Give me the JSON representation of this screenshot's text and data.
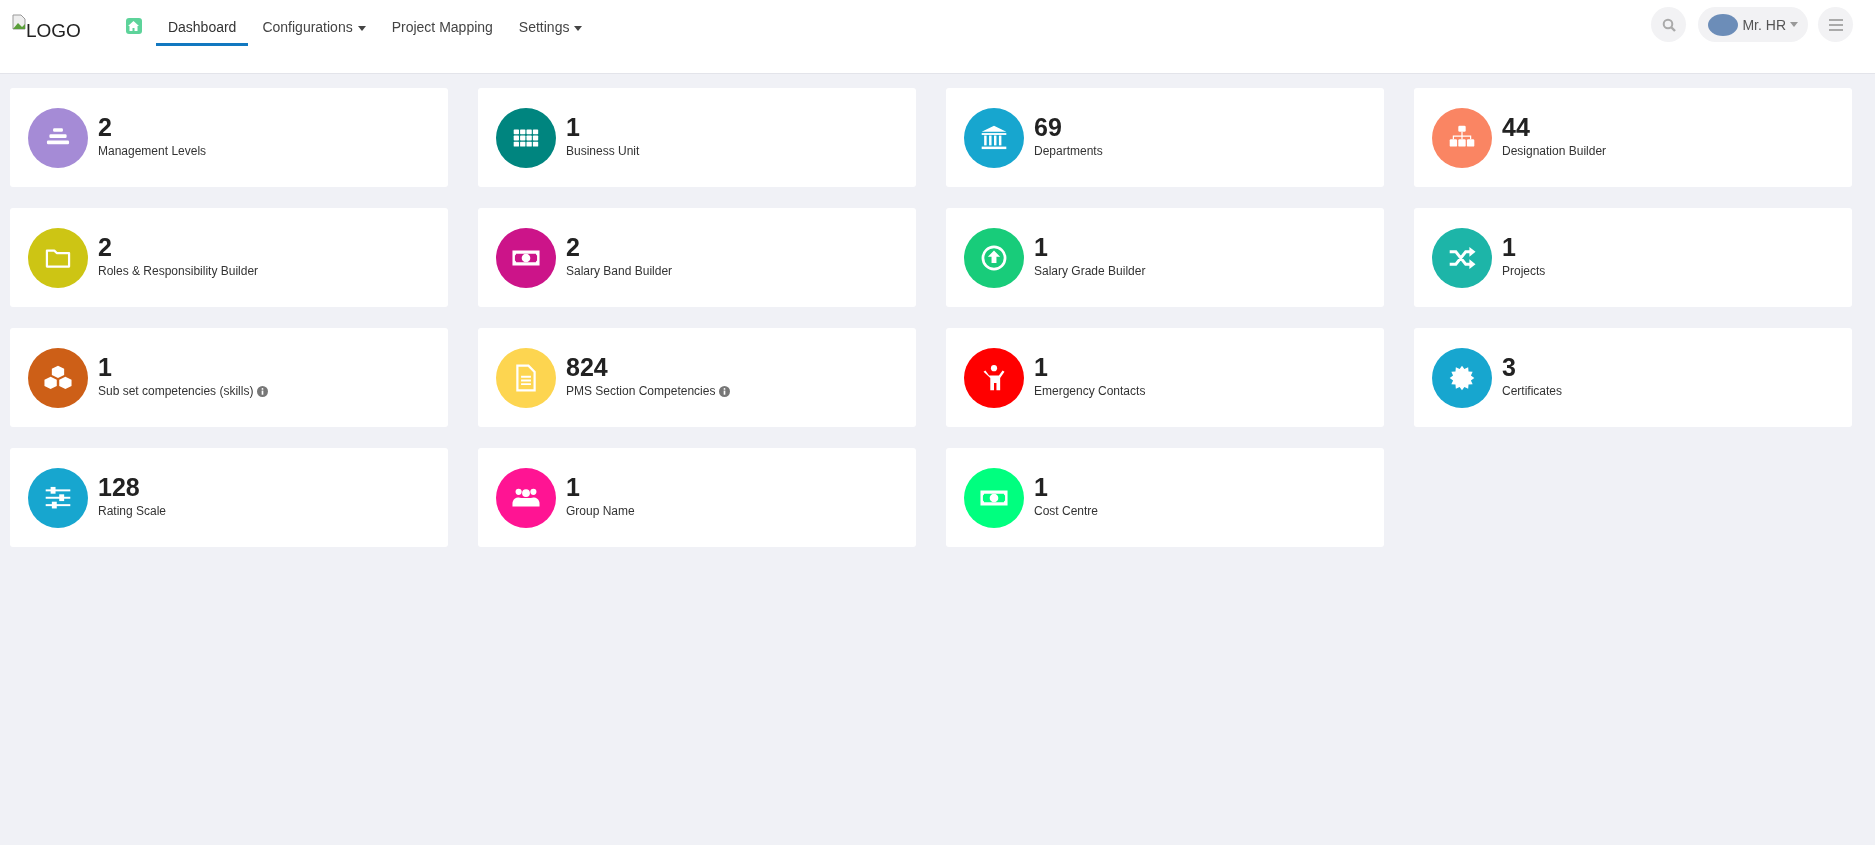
{
  "header": {
    "logo": {
      "alt_text": "LOGO"
    },
    "nav": [
      {
        "label": "Dashboard",
        "selected": true,
        "dropdown": false
      },
      {
        "label": "Configurations",
        "selected": false,
        "dropdown": true
      },
      {
        "label": "Project Mapping",
        "selected": false,
        "dropdown": false
      },
      {
        "label": "Settings",
        "selected": false,
        "dropdown": true
      }
    ],
    "user": {
      "name": "Mr. HR"
    }
  },
  "cards": [
    {
      "count": "2",
      "label": "Management Levels",
      "color": "#a58bd6",
      "kind": "levels",
      "info": false
    },
    {
      "count": "1",
      "label": "Business Unit",
      "color": "#00857f",
      "kind": "grid",
      "info": false
    },
    {
      "count": "69",
      "label": "Departments",
      "color": "#17a6cf",
      "kind": "building",
      "info": false
    },
    {
      "count": "44",
      "label": "Designation Builder",
      "color": "#fa8563",
      "kind": "hierarchy",
      "info": false
    },
    {
      "count": "2",
      "label": "Roles & Responsibility Builder",
      "color": "#cdc514",
      "kind": "folder",
      "info": false
    },
    {
      "count": "2",
      "label": "Salary Band Builder",
      "color": "#cc1489",
      "kind": "money",
      "info": false
    },
    {
      "count": "1",
      "label": "Salary Grade Builder",
      "color": "#18cc7a",
      "kind": "up",
      "info": false
    },
    {
      "count": "1",
      "label": "Projects",
      "color": "#1db5a8",
      "kind": "shuffle",
      "info": false
    },
    {
      "count": "1",
      "label": "Sub set competencies (skills)",
      "color": "#cd5f17",
      "kind": "cubes",
      "info": true
    },
    {
      "count": "824",
      "label": "PMS Section Competencies",
      "color": "#fdd550",
      "kind": "document",
      "info": true
    },
    {
      "count": "1",
      "label": "Emergency Contacts",
      "color": "#ff0000",
      "kind": "person",
      "info": false
    },
    {
      "count": "3",
      "label": "Certificates",
      "color": "#17a6cf",
      "kind": "badge",
      "info": false
    },
    {
      "count": "128",
      "label": "Rating Scale",
      "color": "#17a6cf",
      "kind": "sliders",
      "info": false
    },
    {
      "count": "1",
      "label": "Group Name",
      "color": "#ff1493",
      "kind": "group",
      "info": false
    },
    {
      "count": "1",
      "label": "Cost Centre",
      "color": "#00ff7f",
      "kind": "money",
      "info": false
    }
  ]
}
